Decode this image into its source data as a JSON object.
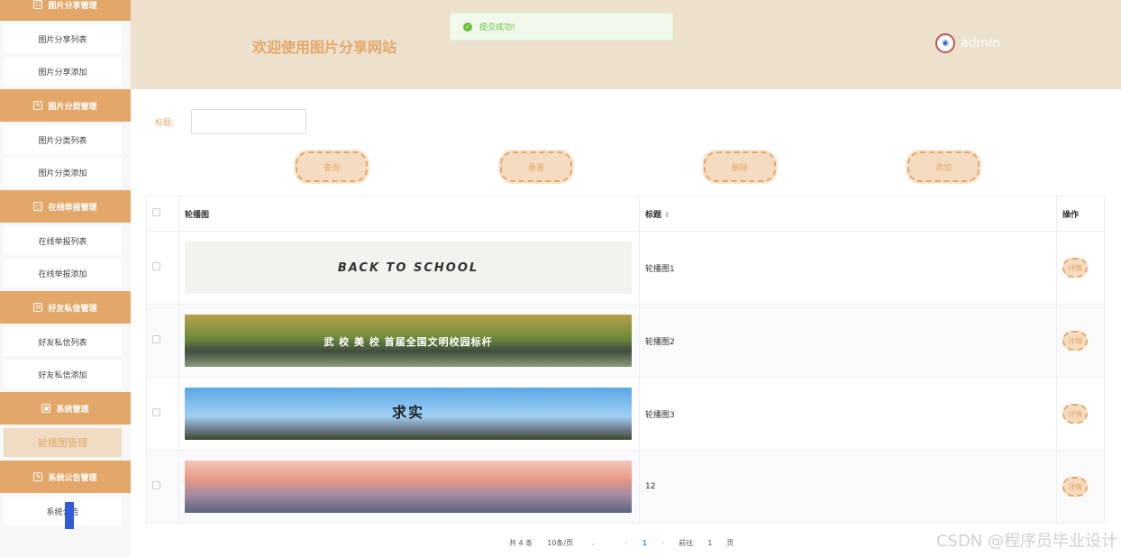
{
  "sidebar": {
    "groups": [
      {
        "label": "图片分享管理",
        "items": [
          "图片分享列表",
          "图片分享添加"
        ]
      },
      {
        "label": "图片分类管理",
        "items": [
          "图片分类列表",
          "图片分类添加"
        ]
      },
      {
        "label": "在线举报管理",
        "items": [
          "在线举报列表",
          "在线举报添加"
        ]
      },
      {
        "label": "好友私信管理",
        "items": [
          "好友私信列表",
          "好友私信添加"
        ]
      },
      {
        "label": "系统管理",
        "items": [
          "轮播图管理"
        ]
      },
      {
        "label": "系统公告管理",
        "items": [
          "系统公告"
        ]
      }
    ]
  },
  "header": {
    "title": "欢迎使用图片分享网站",
    "username": "admin"
  },
  "toast": {
    "message": "提交成功!"
  },
  "search": {
    "label": "标题:",
    "value": ""
  },
  "buttons": {
    "query": "查询",
    "reset": "重置",
    "delete": "删除",
    "add": "添加"
  },
  "table": {
    "columns": {
      "image": "轮播图",
      "title": "标题",
      "action": "操作"
    },
    "rows": [
      {
        "banner_text": "BACK TO SCHOOL",
        "title": "轮播图1",
        "action": "详情"
      },
      {
        "banner_text": "武 校 美 校  首届全国文明校园标杆",
        "title": "轮播图2",
        "action": "详情"
      },
      {
        "banner_text": "求实",
        "title": "轮播图3",
        "action": "详情"
      },
      {
        "banner_text": "",
        "title": "12",
        "action": "详情"
      }
    ]
  },
  "pagination": {
    "total": "共 4 条",
    "page_size": "10条/页",
    "current": "1",
    "goto_label": "前往",
    "goto_value": "1",
    "page_unit": "页"
  },
  "watermark": "CSDN @程序员毕业设计",
  "colors": {
    "accent": "#e3a869",
    "header_bg": "#ede0cd",
    "success": "#67c23a"
  }
}
